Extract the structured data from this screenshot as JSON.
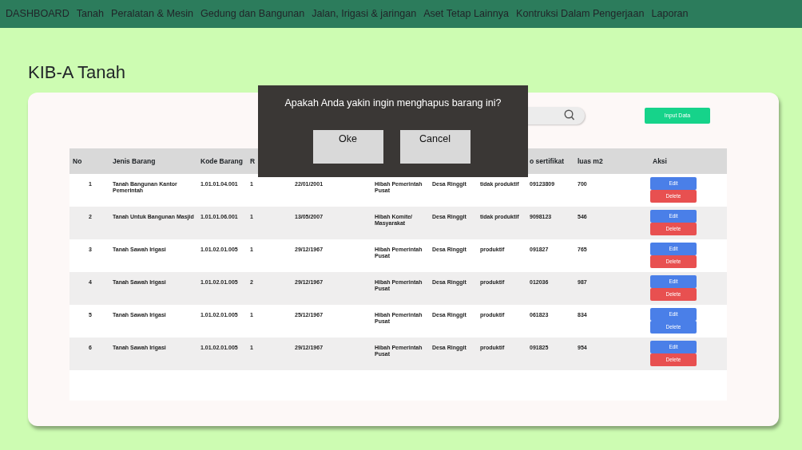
{
  "nav": [
    "DASHBOARD",
    "Tanah",
    "Peralatan & Mesin",
    "Gedung dan Bangunan",
    "Jalan, Irigasi & jaringan",
    "Aset Tetap Lainnya",
    "Kontruksi Dalam Pengerjaan",
    "Laporan"
  ],
  "title": "KIB-A Tanah",
  "input_button": "Input Data",
  "columns_left": [
    "No",
    "Jenis Barang",
    "Kode Barang",
    "R"
  ],
  "columns_right": [
    "o sertifikat",
    "luas m2",
    "Aksi"
  ],
  "rows": [
    {
      "cells": [
        "1",
        "Tanah Bangunan Kantor Pemerintah",
        "1.01.01.04.001",
        "1",
        "22/01/2001",
        "Hibah Pemerintah Pusat",
        "Desa Ringgit",
        "tidak produktif",
        "09123809",
        "700"
      ],
      "actions": [
        {
          "label": "Edit",
          "color": "#4a7fe8"
        },
        {
          "label": "Delete",
          "color": "#e85050"
        }
      ]
    },
    {
      "cells": [
        "2",
        "Tanah Untuk Bangunan Masjid",
        "1.01.01.06.001",
        "1",
        "13/05/2007",
        "Hibah Komite/ Masyarakat",
        "Desa Ringgit",
        "tidak produktif",
        "9098123",
        "546"
      ],
      "actions": [
        {
          "label": "Edit",
          "color": "#4a7fe8"
        },
        {
          "label": "Delete",
          "color": "#e85050"
        }
      ]
    },
    {
      "cells": [
        "3",
        "Tanah Sawah Irigasi",
        "1.01.02.01.005",
        "1",
        "29/12/1967",
        "Hibah Pemerintah Pusat",
        "Desa Ringgit",
        "produktif",
        "091827",
        "765"
      ],
      "actions": [
        {
          "label": "Edit",
          "color": "#4a7fe8"
        },
        {
          "label": "Delete",
          "color": "#e85050"
        }
      ]
    },
    {
      "cells": [
        "4",
        "Tanah Sawah Irigasi",
        "1.01.02.01.005",
        "2",
        "29/12/1967",
        "Hibah Pemerintah Pusat",
        "Desa Ringgit",
        "produktif",
        "012036",
        "987"
      ],
      "actions": [
        {
          "label": "Edit",
          "color": "#4a7fe8"
        },
        {
          "label": "Delete",
          "color": "#e85050"
        }
      ]
    },
    {
      "cells": [
        "5",
        "Tanah Sawah Irigasi",
        "1.01.02.01.005",
        "1",
        "25/12/1967",
        "Hibah Pemerintah Pusat",
        "Desa Ringgit",
        "produktif",
        "061823",
        "834"
      ],
      "actions": [
        {
          "label": "Edit",
          "color": "#4a7fe8"
        },
        {
          "label": "Delete",
          "color": "#4a7fe8"
        }
      ]
    },
    {
      "cells": [
        "6",
        "Tanah Sawah Irigasi",
        "1.01.02.01.005",
        "1",
        "29/12/1967",
        "Hibah Pemerintah Pusat",
        "Desa Ringgit",
        "produktif",
        "091825",
        "954"
      ],
      "actions": [
        {
          "label": "Edit",
          "color": "#4a7fe8"
        },
        {
          "label": "Delete",
          "color": "#e85050"
        }
      ]
    }
  ],
  "dialog": {
    "message": "Apakah Anda yakin ingin menghapus barang ini?",
    "buttons": [
      "Oke",
      "Cancel"
    ]
  }
}
